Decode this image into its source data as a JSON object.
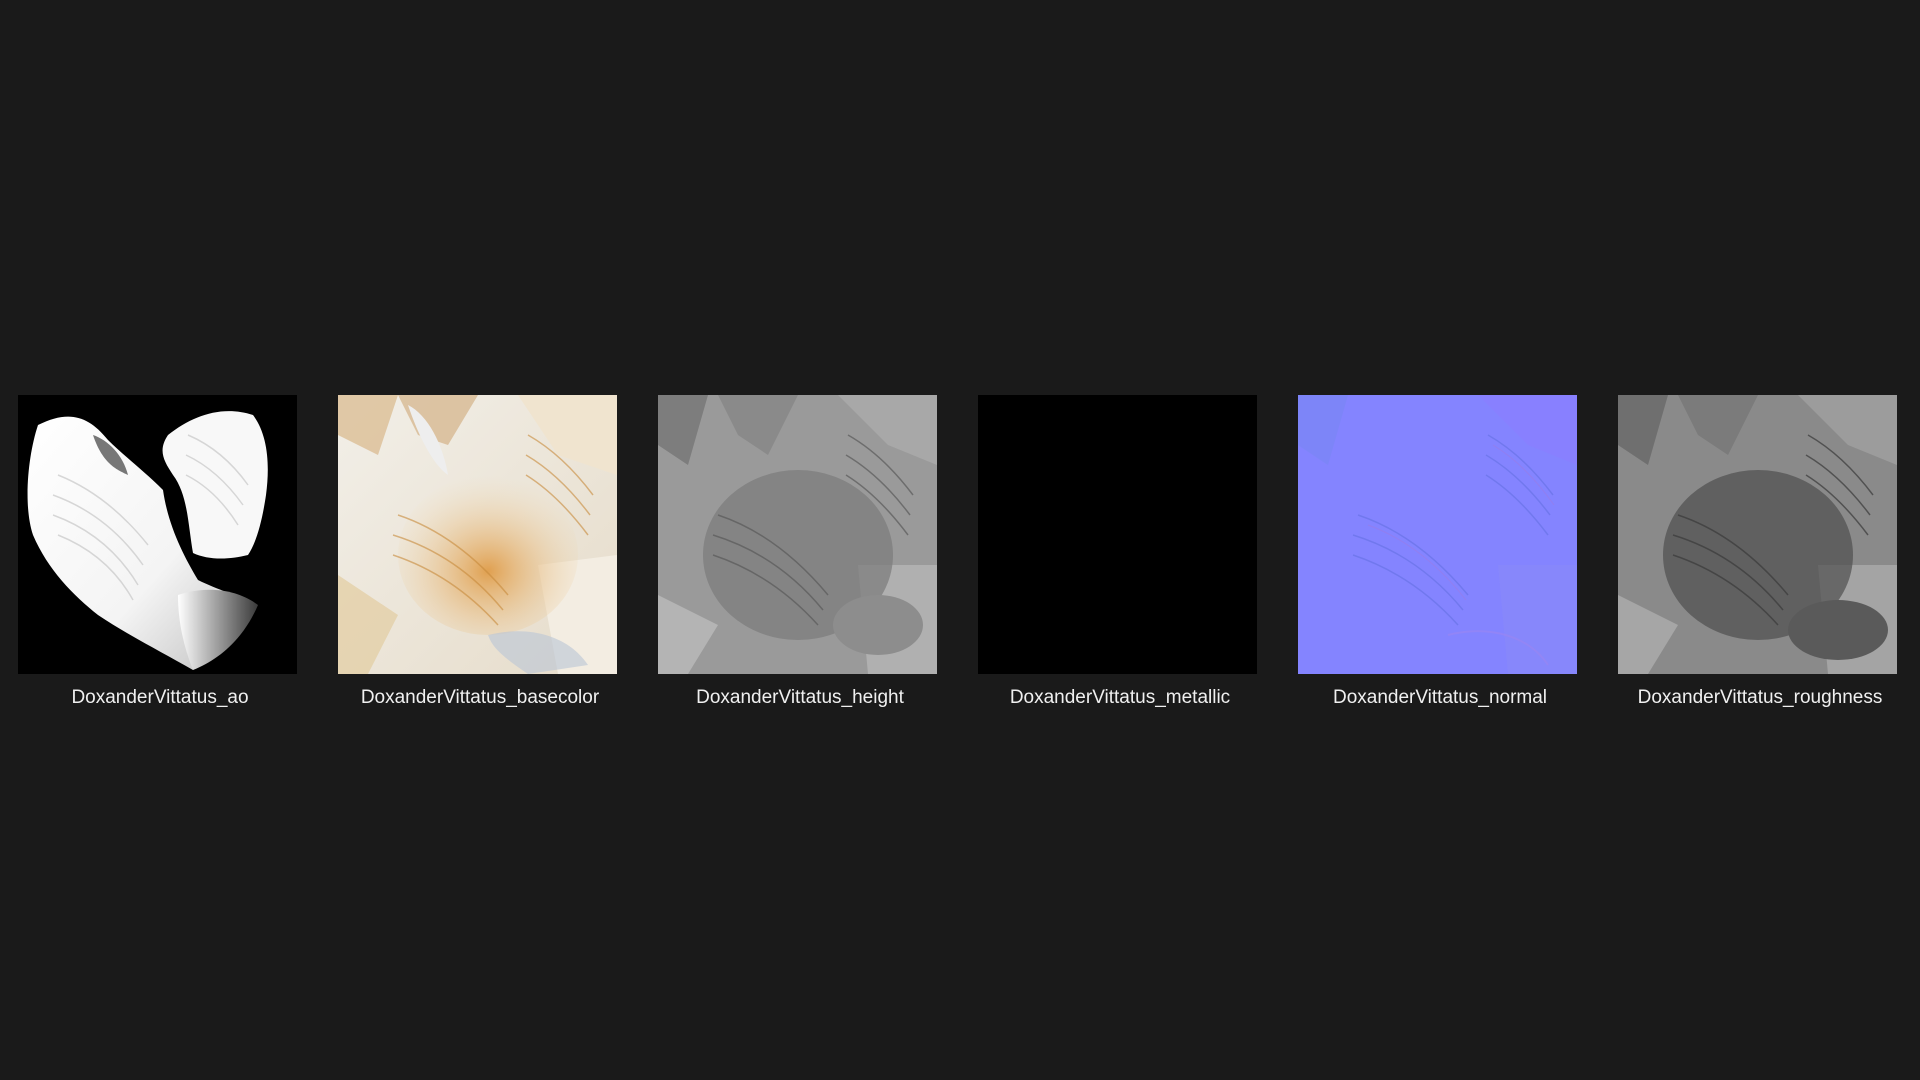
{
  "files": [
    {
      "name": "DoxanderVittatus_ao",
      "thumbnail": "ao-map"
    },
    {
      "name": "DoxanderVittatus_basecolor",
      "thumbnail": "basecolor-map"
    },
    {
      "name": "DoxanderVittatus_height",
      "thumbnail": "height-map"
    },
    {
      "name": "DoxanderVittatus_metallic",
      "thumbnail": "metallic-map"
    },
    {
      "name": "DoxanderVittatus_normal",
      "thumbnail": "normal-map"
    },
    {
      "name": "DoxanderVittatus_roughness",
      "thumbnail": "roughness-map"
    }
  ],
  "colors": {
    "background": "#1a1a1a",
    "label": "#f0f0f0",
    "normal_base": "#8484ff"
  }
}
